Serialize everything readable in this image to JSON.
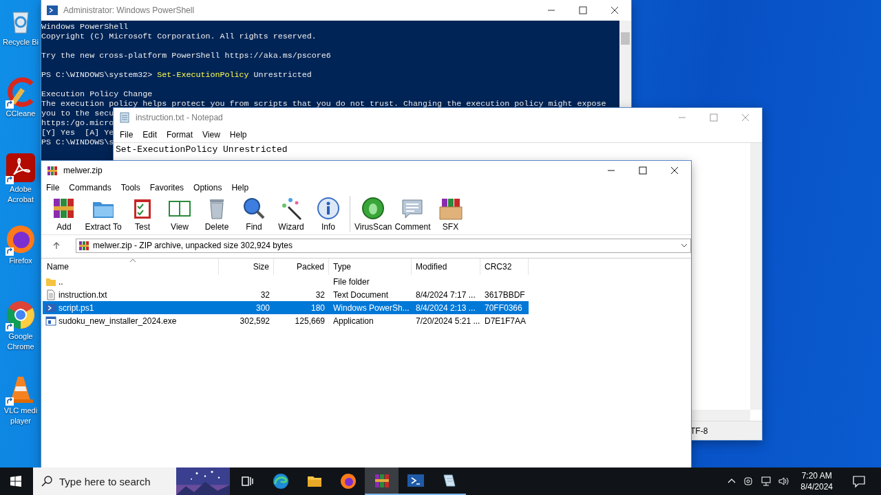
{
  "desktop": {
    "icons": [
      {
        "label": "Recycle Bi",
        "shortcut": false
      },
      {
        "label": "CCleane",
        "shortcut": true
      },
      {
        "label": "Adobe Acrobat",
        "shortcut": true
      },
      {
        "label": "Firefox",
        "shortcut": true
      },
      {
        "label": "Google Chrome",
        "shortcut": true
      },
      {
        "label": "VLC medi player",
        "shortcut": true
      }
    ]
  },
  "powershell": {
    "title": "Administrator: Windows PowerShell",
    "blocks": [
      {
        "lines": [
          {
            "parts": [
              {
                "kind": "plain",
                "text": "Windows PowerShell"
              }
            ]
          },
          {
            "parts": [
              {
                "kind": "plain",
                "text": "Copyright (C) Microsoft Corporation. All rights reserved."
              }
            ]
          }
        ]
      },
      {
        "lines": [
          {
            "parts": [
              {
                "kind": "plain",
                "text": "Try the new cross-platform PowerShell https://aka.ms/pscore6"
              }
            ]
          }
        ]
      },
      {
        "lines": [
          {
            "parts": [
              {
                "kind": "plain",
                "text": "PS C:\\WINDOWS\\system32> "
              },
              {
                "kind": "command",
                "text": "Set-ExecutionPolicy"
              },
              {
                "kind": "plain",
                "text": " Unrestricted"
              }
            ]
          }
        ]
      },
      {
        "lines": [
          {
            "parts": [
              {
                "kind": "plain",
                "text": "Execution Policy Change"
              }
            ]
          },
          {
            "parts": [
              {
                "kind": "plain",
                "text": "The execution policy helps protect you from scripts that you do not trust. Changing the execution policy might expose"
              }
            ]
          },
          {
            "parts": [
              {
                "kind": "plain",
                "text": "you to the secu"
              }
            ]
          },
          {
            "parts": [
              {
                "kind": "plain",
                "text": "https:/go.micro"
              }
            ]
          },
          {
            "parts": [
              {
                "kind": "plain",
                "text": "[Y] Yes  [A] Ye"
              }
            ]
          },
          {
            "parts": [
              {
                "kind": "plain",
                "text": "PS C:\\WINDOWS\\s"
              }
            ]
          }
        ]
      }
    ]
  },
  "notepad": {
    "title": "instruction.txt - Notepad",
    "menu": [
      "File",
      "Edit",
      "Format",
      "View",
      "Help"
    ],
    "content": "Set-ExecutionPolicy Unrestricted",
    "status": "TF-8"
  },
  "winrar": {
    "title": "melwer.zip",
    "menu": [
      "File",
      "Commands",
      "Tools",
      "Favorites",
      "Options",
      "Help"
    ],
    "tool_groups": [
      [
        "Add",
        "Extract To",
        "Test",
        "View",
        "Delete",
        "Find",
        "Wizard",
        "Info"
      ],
      [
        "VirusScan",
        "Comment",
        "SFX"
      ]
    ],
    "address": "melwer.zip - ZIP archive, unpacked size 302,924 bytes",
    "columns": [
      "Name",
      "Size",
      "Packed",
      "Type",
      "Modified",
      "CRC32"
    ],
    "rows": [
      {
        "kind": "folder",
        "selected": false,
        "name": "..",
        "size": "",
        "packed": "",
        "type": "File folder",
        "modified": "",
        "crc": ""
      },
      {
        "kind": "text",
        "selected": false,
        "name": "instruction.txt",
        "size": "32",
        "packed": "32",
        "type": "Text Document",
        "modified": "8/4/2024 7:17 ...",
        "crc": "3617BBDF"
      },
      {
        "kind": "script",
        "selected": true,
        "name": "script.ps1",
        "size": "300",
        "packed": "180",
        "type": "Windows PowerSh...",
        "modified": "8/4/2024 2:13 ...",
        "crc": "70FF0366"
      },
      {
        "kind": "exe",
        "selected": false,
        "name": "sudoku_new_installer_2024.exe",
        "size": "302,592",
        "packed": "125,669",
        "type": "Application",
        "modified": "7/20/2024 5:21 ...",
        "crc": "D7E1F7AA"
      }
    ]
  },
  "taskbar": {
    "search": {
      "placeholder": "Type here to search"
    },
    "apps": [
      {
        "kind": "taskview",
        "running": false,
        "active": false
      },
      {
        "kind": "edge",
        "running": false,
        "active": false
      },
      {
        "kind": "explorer",
        "running": false,
        "active": false
      },
      {
        "kind": "firefox",
        "running": false,
        "active": false
      },
      {
        "kind": "winrar",
        "running": true,
        "active": true
      },
      {
        "kind": "powershell",
        "running": true,
        "active": false
      },
      {
        "kind": "notepad",
        "running": true,
        "active": false
      }
    ],
    "time": "7:20 AM",
    "date": "8/4/2024"
  }
}
